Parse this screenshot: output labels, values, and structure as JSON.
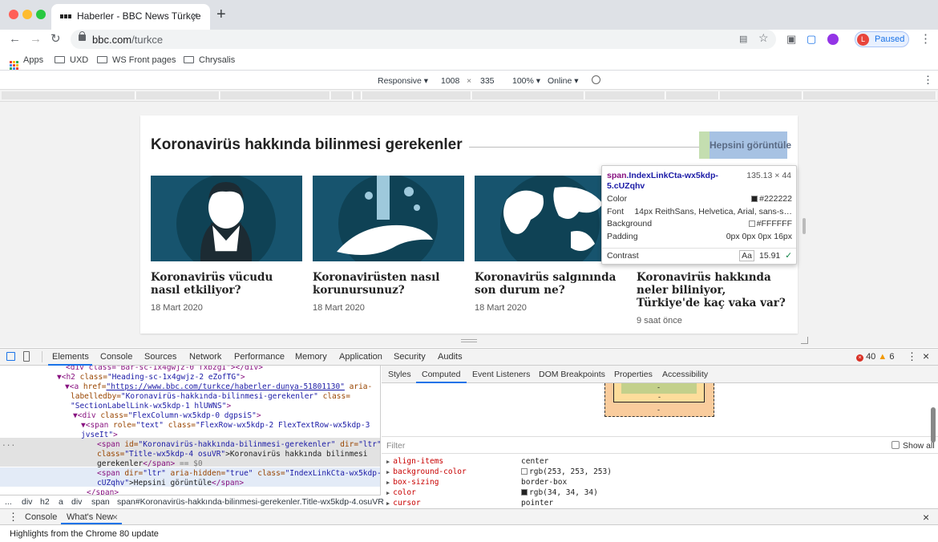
{
  "browser": {
    "tab_title": "Haberler - BBC News Türkçe",
    "tab_close": "×",
    "new_tab": "+",
    "url_host": "bbc.com",
    "url_path": "/turkce",
    "profile_initial": "L",
    "profile_status": "Paused",
    "back": "←",
    "forward": "→",
    "reload": "↻",
    "menu": "⋮",
    "star": "☆"
  },
  "bookmarks": [
    {
      "label": "Apps"
    },
    {
      "label": "UXD"
    },
    {
      "label": "WS Front pages"
    },
    {
      "label": "Chrysalis"
    }
  ],
  "device_toolbar": {
    "mode": "Responsive ▾",
    "width": "1008",
    "times": "×",
    "height": "335",
    "zoom": "100% ▾",
    "throttle": "Online ▾",
    "more": "⋮"
  },
  "page": {
    "section_title": "Koronavirüs hakkında bilinmesi gerekenler",
    "see_all": "Hepsini görüntüle",
    "cards": [
      {
        "headline": "Koronavirüs vücudu nasıl etkiliyor?",
        "date": "18 Mart 2020"
      },
      {
        "headline": "Koronavirüsten nasıl korunursunuz?",
        "date": "18 Mart 2020"
      },
      {
        "headline": "Koronavirüs salgınında son durum ne?",
        "date": "18 Mart 2020"
      },
      {
        "headline": "Koronavirüs hakkında neler biliniyor, Türkiye'de kaç vaka var?",
        "date": "9 saat önce"
      }
    ]
  },
  "tooltip": {
    "tag": "span",
    "class_name": ".IndexLinkCta-wx5kdp-5.cUZqhv",
    "dims": "135.13 × 44",
    "rows": [
      {
        "label": "Color",
        "value": "#222222",
        "swatch": "#222222"
      },
      {
        "label": "Font",
        "value": "14px ReithSans, Helvetica, Arial, sans-s…"
      },
      {
        "label": "Background",
        "value": "#FFFFFF",
        "swatch": "#FFFFFF"
      },
      {
        "label": "Padding",
        "value": "0px 0px 0px 16px"
      }
    ],
    "contrast_label": "Contrast",
    "contrast_aa": "Aa",
    "contrast_value": "15.91",
    "contrast_check": "✓"
  },
  "devtools": {
    "tabs": [
      "Elements",
      "Console",
      "Sources",
      "Network",
      "Performance",
      "Memory",
      "Application",
      "Security",
      "Audits"
    ],
    "errors": "40",
    "warnings": "6",
    "side_tabs": [
      "Styles",
      "Computed",
      "Event Listeners",
      "DOM Breakpoints",
      "Properties",
      "Accessibility"
    ],
    "active_side_tab": "Computed",
    "filter_placeholder": "Filter",
    "show_all": "Show all",
    "box_dash": "-",
    "properties": [
      {
        "name": "align-items",
        "value": "center"
      },
      {
        "name": "background-color",
        "value": "rgb(253, 253, 253)",
        "swatch": "#fdfdfd"
      },
      {
        "name": "box-sizing",
        "value": "border-box"
      },
      {
        "name": "color",
        "value": "rgb(34, 34, 34)",
        "swatch": "#222222"
      },
      {
        "name": "cursor",
        "value": "pointer"
      }
    ],
    "crumbs": [
      "...",
      "div",
      "h2",
      "a",
      "div",
      "span",
      "span#Koronavirüs-hakkında-bilinmesi-gerekenler.Title-wx5kdp-4.osuVR"
    ],
    "drawer_tabs": [
      "Console",
      "What's New"
    ],
    "status": "Highlights from the Chrome 80 update"
  },
  "dom_lines": {
    "l0": "<div class=\"Bar-sc-1x4gwjz-0 fxbzgI\"></div>",
    "l1_tag": "▼<h2 ",
    "l1_an": "class=",
    "l1_av": "\"Heading-sc-1x4gwjz-2 eZofTG\"",
    "l1_end": ">",
    "l2_tag": "▼<a ",
    "l2_an": "href=",
    "l2_lk": "\"https://www.bbc.com/turkce/haberler-dunya-51801130\"",
    "l2_an2": " aria-",
    "l3_an": "labelledby=",
    "l3_av": "\"Koronavirüs-hakkında-bilinmesi-gerekenler\"",
    "l3_an2": " class=",
    "l4_av": "\"SectionLabelLink-wx5kdp-1 hlUWNS\"",
    "l4_end": ">",
    "l5_tag": "▼<div ",
    "l5_an": "class=",
    "l5_av": "\"FlexColumn-wx5kdp-0 dgpsiS\"",
    "l5_end": ">",
    "l6_tag": "▼<span ",
    "l6_an": "role=",
    "l6_av": "\"text\"",
    "l6_an2": " class=",
    "l6_av2": "\"FlexRow-wx5kdp-2 FlexTextRow-wx5kdp-3",
    "l7_av": "jvseIt\"",
    "l7_end": ">",
    "l8_dots": "...",
    "l8_tag": "<span ",
    "l8_an": "id=",
    "l8_av": "\"Koronavirüs-hakkında-bilinmesi-gerekenler\"",
    "l8_an2": " dir=",
    "l8_av2": "\"ltr\"",
    "l9_an": "class=",
    "l9_av": "\"Title-wx5kdp-4 osuVR\"",
    "l9_tx": ">Koronavirüs hakkında bilinmesi",
    "l10_tx": "gerekenler",
    "l10_tag": "</span>",
    "l10_eq": " == $0",
    "l11_tag": "<span ",
    "l11_an": "dir=",
    "l11_av": "\"ltr\"",
    "l11_an2": " aria-hidden=",
    "l11_av2": "\"true\"",
    "l11_an3": " class=",
    "l11_av3": "\"IndexLinkCta-wx5kdp-5",
    "l12_av": "cUZqhv\"",
    "l12_tx": ">Hepsini görüntüle",
    "l12_tag": "</span>",
    "l13": "</span>"
  },
  "colors": {
    "accent": "#1a73e8",
    "bbc_dark_teal": "#17546e",
    "highlight_content": "#a7c2e3",
    "highlight_padding": "#c4deb0"
  }
}
